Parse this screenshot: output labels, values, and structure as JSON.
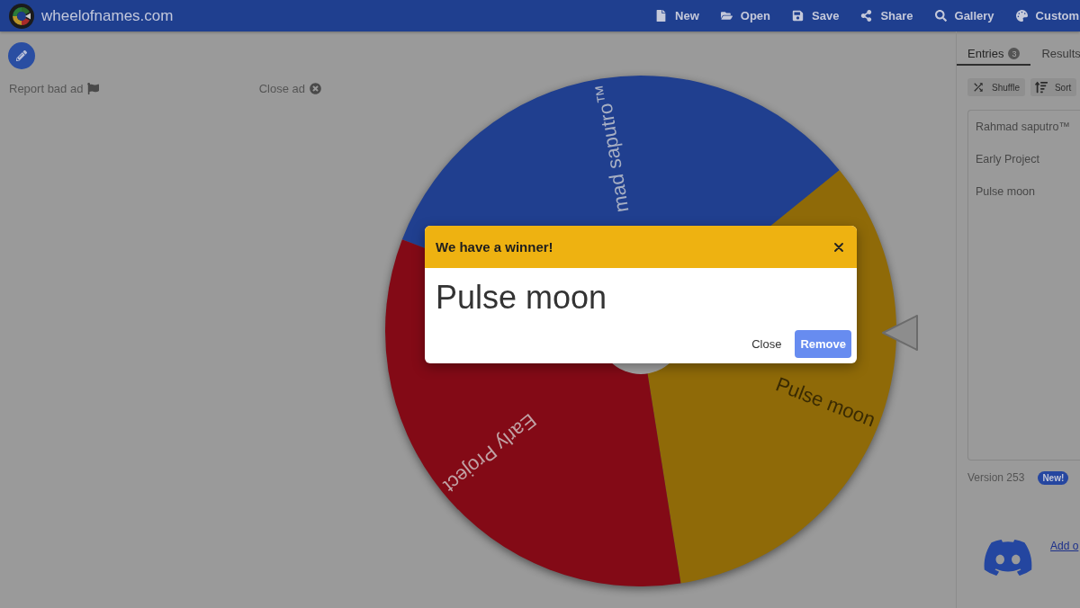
{
  "header": {
    "title": "wheelofnames.com",
    "nav": [
      {
        "label": "New",
        "kind": "new"
      },
      {
        "label": "Open",
        "kind": "open"
      },
      {
        "label": "Save",
        "kind": "save"
      },
      {
        "label": "Share",
        "kind": "share"
      },
      {
        "label": "Gallery",
        "kind": "gallery"
      },
      {
        "label": "Custom",
        "kind": "customize"
      }
    ]
  },
  "ad_bar": {
    "report": "Report bad ad",
    "close": "Close ad"
  },
  "wheel": {
    "slices": [
      {
        "label": "mad saputro™",
        "color": "#203f8f"
      },
      {
        "label": "Pulse moon",
        "color": "#8f6a08"
      },
      {
        "label": "Early Project",
        "color": "#830a16"
      }
    ]
  },
  "winner_dialog": {
    "title": "We have a winner!",
    "winner": "Pulse moon",
    "buttons": [
      {
        "label": "Close",
        "kind": "text"
      },
      {
        "label": "Remove",
        "kind": "primary"
      }
    ]
  },
  "sidebar": {
    "tabs": [
      {
        "label": "Entries",
        "count": "3",
        "selected": true
      },
      {
        "label": "Results",
        "selected": false
      }
    ],
    "tools": [
      {
        "label": "Shuffle",
        "kind": "shuffle"
      },
      {
        "label": "Sort",
        "kind": "sort"
      }
    ],
    "entries": [
      "Rahmad saputro™",
      "Early Project",
      "Pulse moon"
    ],
    "version": "Version 253",
    "version_badge": "New!",
    "link": "Add o"
  }
}
